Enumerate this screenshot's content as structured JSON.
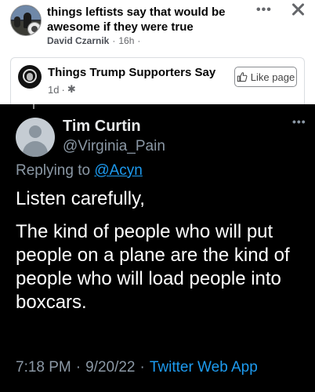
{
  "post": {
    "title": "things leftists say that would be awesome if they were true",
    "author": "David Czarnik",
    "time": "16h",
    "more_icon": "more-horizontal-icon",
    "close_icon": "close-icon"
  },
  "shared_page": {
    "name": "Things Trump Supporters Say",
    "time": "1d",
    "settings_icon": "gear-icon",
    "like_button": "Like page"
  },
  "tweet": {
    "name": "Tim Curtin",
    "handle": "@Virginia_Pain",
    "replying_prefix": "Replying to",
    "replying_to": "@Acyn",
    "line1": "Listen carefully,",
    "line2": "The kind of people who will put people on a plane are the kind of people who will load people into boxcars.",
    "time": "7:18 PM",
    "date": "9/20/22",
    "app": "Twitter Web App",
    "colors": {
      "background": "#000000",
      "link": "#1d9bf0",
      "muted": "#8b98a5"
    }
  }
}
